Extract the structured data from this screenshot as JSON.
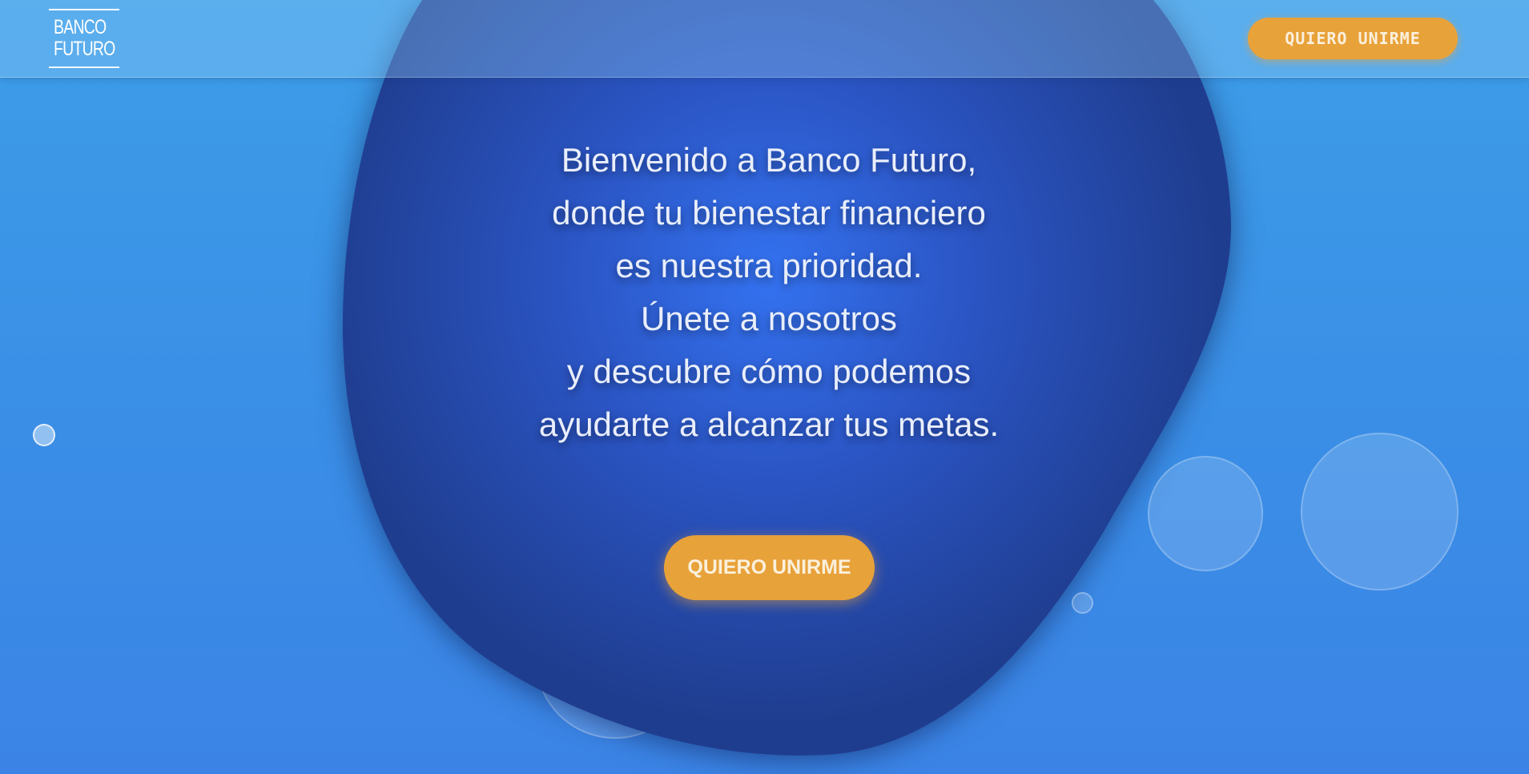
{
  "header": {
    "logo_line1": "BANCO",
    "logo_line2": "FUTURO",
    "cta_label": "QUIERO UNIRME"
  },
  "hero": {
    "lines": [
      "Bienvenido a Banco Futuro,",
      "donde tu bienestar financiero",
      "es nuestra prioridad.",
      "Únete a nosotros",
      "y descubre cómo podemos",
      "ayudarte a alcanzar tus metas."
    ],
    "cta_label": "QUIERO UNIRME"
  },
  "colors": {
    "background": "#3a8ee6",
    "blob": "#2a4db0",
    "accent": "#e8a23a",
    "text": "#e9eefb"
  }
}
